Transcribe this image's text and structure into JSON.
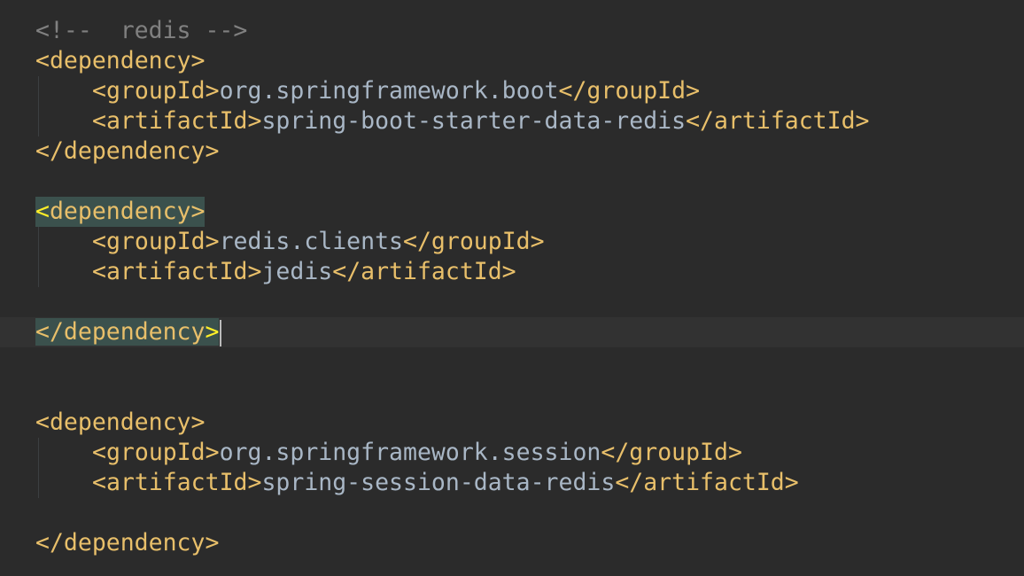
{
  "editor": {
    "lines": [
      {
        "id": "l1",
        "comment": "<!--  redis -->"
      },
      {
        "id": "l2",
        "open": "<",
        "tag": "dependency",
        "close": ">"
      },
      {
        "id": "l3",
        "parts": [
          "<groupId>",
          "org.springframework.boot",
          "</groupId>"
        ]
      },
      {
        "id": "l4",
        "parts": [
          "<artifactId>",
          "spring-boot-starter-data-redis",
          "</artifactId>"
        ]
      },
      {
        "id": "l5",
        "text": "</dependency>"
      },
      {
        "id": "l7",
        "open": "<",
        "tag": "dependency",
        "close": ">"
      },
      {
        "id": "l8",
        "parts": [
          "<groupId>",
          "redis.clients",
          "</groupId>"
        ]
      },
      {
        "id": "l9",
        "parts": [
          "<artifactId>",
          "jedis",
          "</artifactId>"
        ]
      },
      {
        "id": "l11",
        "open": "</",
        "tag": "dependency",
        "close": ">"
      },
      {
        "id": "l14",
        "text": "<dependency>"
      },
      {
        "id": "l15",
        "parts": [
          "<groupId>",
          "org.springframework.session",
          "</groupId>"
        ]
      },
      {
        "id": "l16",
        "parts": [
          "<artifactId>",
          "spring-session-data-redis",
          "</artifactId>"
        ]
      },
      {
        "id": "l18",
        "text": "</dependency>"
      }
    ]
  },
  "colors": {
    "background": "#2b2b2b",
    "current_line": "#323232",
    "comment": "#808080",
    "tag": "#e8bf6a",
    "text": "#a9b7c6",
    "brace_match_bg": "#3b514d",
    "brace_match_fg": "#ffef28"
  }
}
